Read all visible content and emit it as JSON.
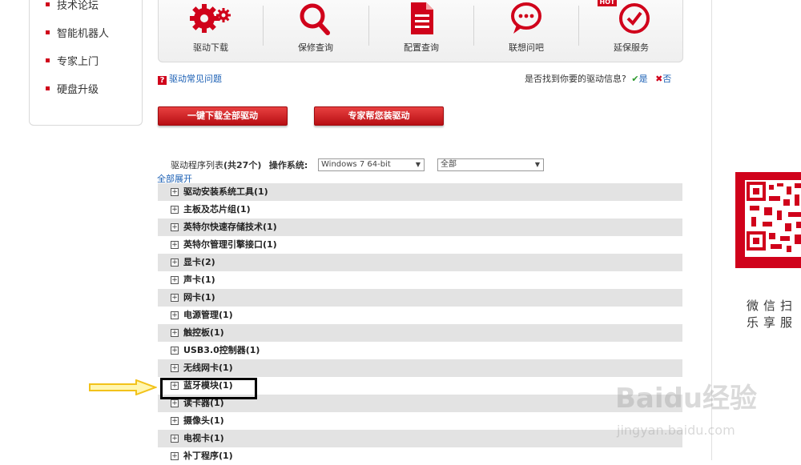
{
  "sidebar": {
    "items": [
      {
        "label": "技术论坛"
      },
      {
        "label": "智能机器人"
      },
      {
        "label": "专家上门"
      },
      {
        "label": "硬盘升级"
      }
    ]
  },
  "tools": {
    "items": [
      {
        "label": "驱动下载",
        "icon": "gears-icon"
      },
      {
        "label": "保修查询",
        "icon": "magnifier-icon"
      },
      {
        "label": "配置查询",
        "icon": "document-icon"
      },
      {
        "label": "联想问吧",
        "icon": "chat-bubble-icon"
      },
      {
        "label": "延保服务",
        "icon": "clock-check-icon",
        "badge": "HOT"
      }
    ]
  },
  "faq_link": "驱动常见问题",
  "found_prompt": "是否找到你要的驱动信息?",
  "found_yes": "是",
  "found_no": "否",
  "buttons": {
    "download_all": "一键下载全部驱动",
    "expert_install": "专家帮您装驱动"
  },
  "list_header": {
    "prefix": "驱动程序列表",
    "count": "(共27个)",
    "os_label": "操作系统:",
    "os_value": "Windows 7 64-bit",
    "filter_value": "全部",
    "expand_all": "全部展开"
  },
  "driver_categories": [
    {
      "label": "驱动安装系统工具(1)"
    },
    {
      "label": "主板及芯片组(1)"
    },
    {
      "label": "英特尔快速存储技术(1)"
    },
    {
      "label": "英特尔管理引擎接口(1)"
    },
    {
      "label": "显卡(2)"
    },
    {
      "label": "声卡(1)"
    },
    {
      "label": "网卡(1)"
    },
    {
      "label": "电源管理(1)"
    },
    {
      "label": "触控板(1)"
    },
    {
      "label": "USB3.0控制器(1)"
    },
    {
      "label": "无线网卡(1)"
    },
    {
      "label": "蓝牙模块(1)"
    },
    {
      "label": "读卡器(1)"
    },
    {
      "label": "摄像头(1)"
    },
    {
      "label": "电视卡(1)"
    },
    {
      "label": "补丁程序(1)"
    }
  ],
  "qr": {
    "line1": "微信扫",
    "line2": "乐享服"
  },
  "watermark": {
    "logo": "Baidu经验",
    "url": "jingyan.baidu.com"
  },
  "colors": {
    "accent_red": "#d0021b",
    "link_blue": "#1a5fb4",
    "row_shade": "#e3e3e3",
    "arrow_yellow": "#f2c21a"
  }
}
